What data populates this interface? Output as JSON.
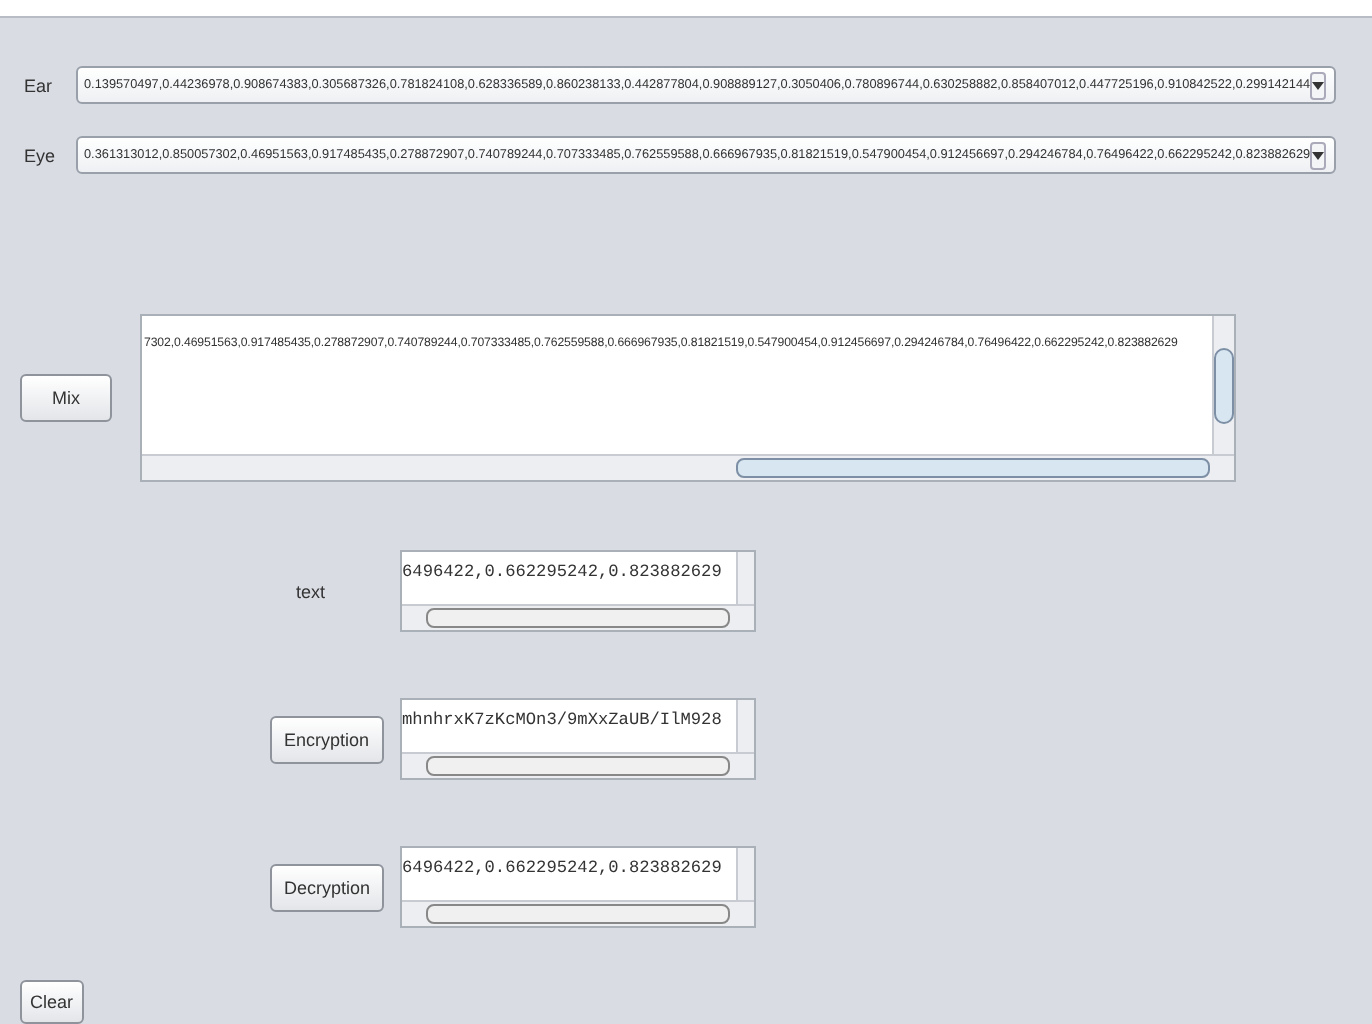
{
  "selectors": [
    {
      "label": "Ear",
      "value": "0.139570497,0.44236978,0.908674383,0.305687326,0.781824108,0.628336589,0.860238133,0.442877804,0.908889127,0.3050406,0.780896744,0.630258882,0.858407012,0.447725196,0.910842522,0.299142144"
    },
    {
      "label": "Eye",
      "value": "0.361313012,0.850057302,0.46951563,0.917485435,0.278872907,0.740789244,0.707333485,0.762559588,0.666967935,0.81821519,0.547900454,0.912456697,0.294246784,0.76496422,0.662295242,0.823882629"
    }
  ],
  "mix": {
    "button": "Mix",
    "output": "7302,0.46951563,0.917485435,0.278872907,0.740789244,0.707333485,0.762559588,0.666967935,0.81821519,0.547900454,0.912456697,0.294246784,0.76496422,0.662295242,0.823882629"
  },
  "rows": [
    {
      "kind": "label",
      "caption": "text",
      "value": "6496422,0.662295242,0.823882629"
    },
    {
      "kind": "button",
      "caption": "Encryption",
      "value": "mhnhrxK7zKcMOn3/9mXxZaUB/IlM928"
    },
    {
      "kind": "button",
      "caption": "Decryption",
      "value": "6496422,0.662295242,0.823882629"
    }
  ],
  "clear": "Clear"
}
